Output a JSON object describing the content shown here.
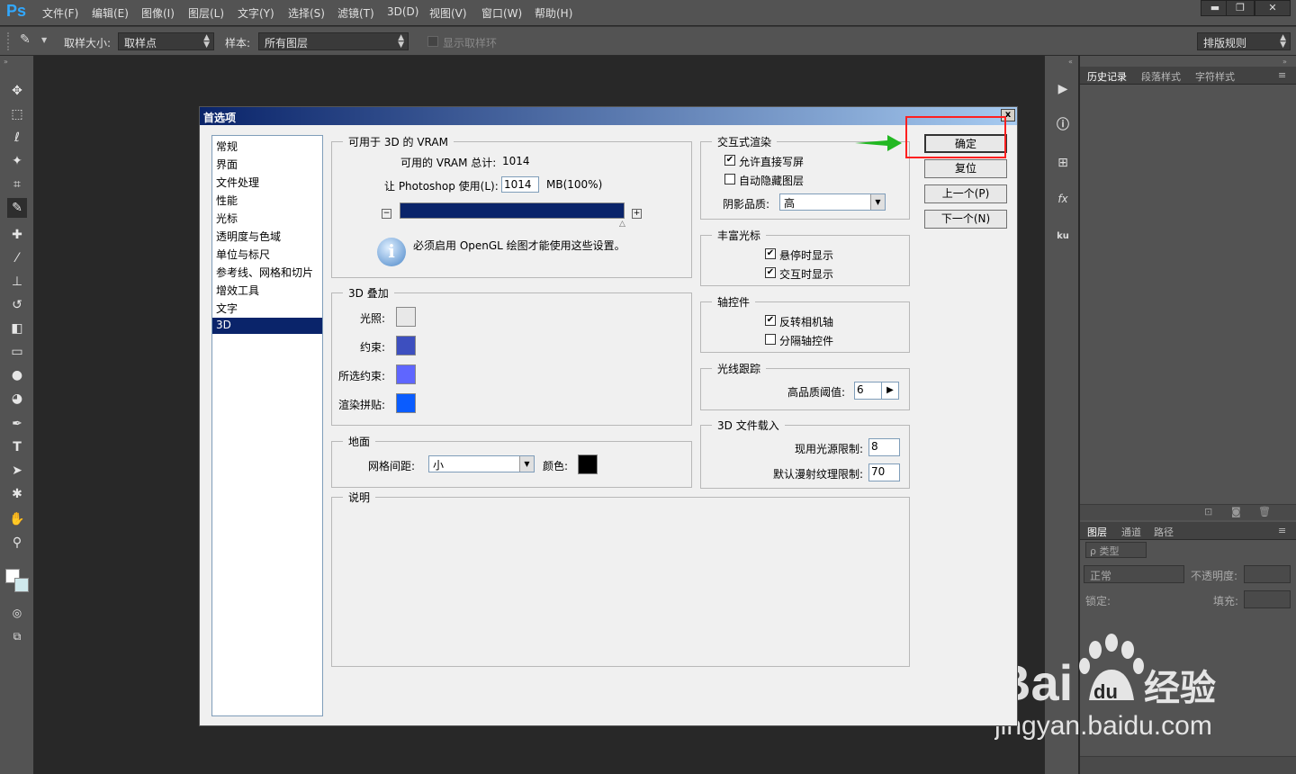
{
  "app": {
    "logo": "Ps"
  },
  "menu": [
    "文件(F)",
    "编辑(E)",
    "图像(I)",
    "图层(L)",
    "文字(Y)",
    "选择(S)",
    "滤镜(T)",
    "3D(D)",
    "视图(V)",
    "窗口(W)",
    "帮助(H)"
  ],
  "window_controls": {
    "minimize": "▬",
    "restore": "❐",
    "close": "✕"
  },
  "options": {
    "sample_size_label": "取样大小:",
    "sample_size_value": "取样点",
    "sample_label": "样本:",
    "sample_value": "所有图层",
    "show_ring_label": "显示取样环",
    "workspace": "排版规则"
  },
  "right_panels": {
    "top_tabs": [
      "历史记录",
      "段落样式",
      "字符样式"
    ],
    "bottom_tabs": [
      "图层",
      "通道",
      "路径"
    ],
    "filter_kind": "ρ 类型",
    "blend_mode": "正常",
    "opacity_label": "不透明度:",
    "lock_label": "锁定:",
    "fill_label": "填充:"
  },
  "dialog": {
    "title": "首选项",
    "close": "x",
    "categories": [
      "常规",
      "界面",
      "文件处理",
      "性能",
      "光标",
      "透明度与色域",
      "单位与标尺",
      "参考线、网格和切片",
      "增效工具",
      "文字",
      "3D"
    ],
    "selected_category": "3D",
    "vram": {
      "title": "可用于 3D 的 VRAM",
      "total_label": "可用的 VRAM 总计:",
      "total_value": "1014",
      "use_label": "让 Photoshop 使用(L):",
      "use_value": "1014",
      "use_unit": "MB(100%)",
      "slider_fraction": 1.0,
      "info_text": "必须启用 OpenGL 绘图才能使用这些设置。"
    },
    "overlay": {
      "title": "3D 叠加",
      "items": [
        {
          "label": "光照:",
          "color": "#e8e8e8"
        },
        {
          "label": "约束:",
          "color": "#3d4fbf"
        },
        {
          "label": "所选约束:",
          "color": "#5f66ff"
        },
        {
          "label": "渲染拼贴:",
          "color": "#0a5cff"
        }
      ]
    },
    "ground": {
      "title": "地面",
      "grid_label": "网格间距:",
      "grid_value": "小",
      "color_label": "颜色:",
      "color": "#000000"
    },
    "description": {
      "title": "说明"
    },
    "interactive": {
      "title": "交互式渲染",
      "opt1": "允许直接写屏",
      "opt1_checked": true,
      "opt2": "自动隐藏图层",
      "opt2_checked": false,
      "shadow_label": "阴影品质:",
      "shadow_value": "高"
    },
    "rich_cursor": {
      "title": "丰富光标",
      "opt1": "悬停时显示",
      "opt1_checked": true,
      "opt2": "交互时显示",
      "opt2_checked": true
    },
    "axis": {
      "title": "轴控件",
      "opt1": "反转相机轴",
      "opt1_checked": true,
      "opt2": "分隔轴控件",
      "opt2_checked": false
    },
    "raytrace": {
      "title": "光线跟踪",
      "threshold_label": "高品质阈值:",
      "threshold_value": "6"
    },
    "file_load": {
      "title": "3D 文件载入",
      "light_label": "现用光源限制:",
      "light_value": "8",
      "texture_label": "默认漫射纹理限制:",
      "texture_value": "70"
    },
    "buttons": {
      "ok": "确定",
      "reset": "复位",
      "prev": "上一个(P)",
      "next": "下一个(N)"
    }
  },
  "watermark": {
    "brand": "Bai",
    "brand2": "du",
    "cn": "经验",
    "url": "jingyan.baidu.com"
  }
}
